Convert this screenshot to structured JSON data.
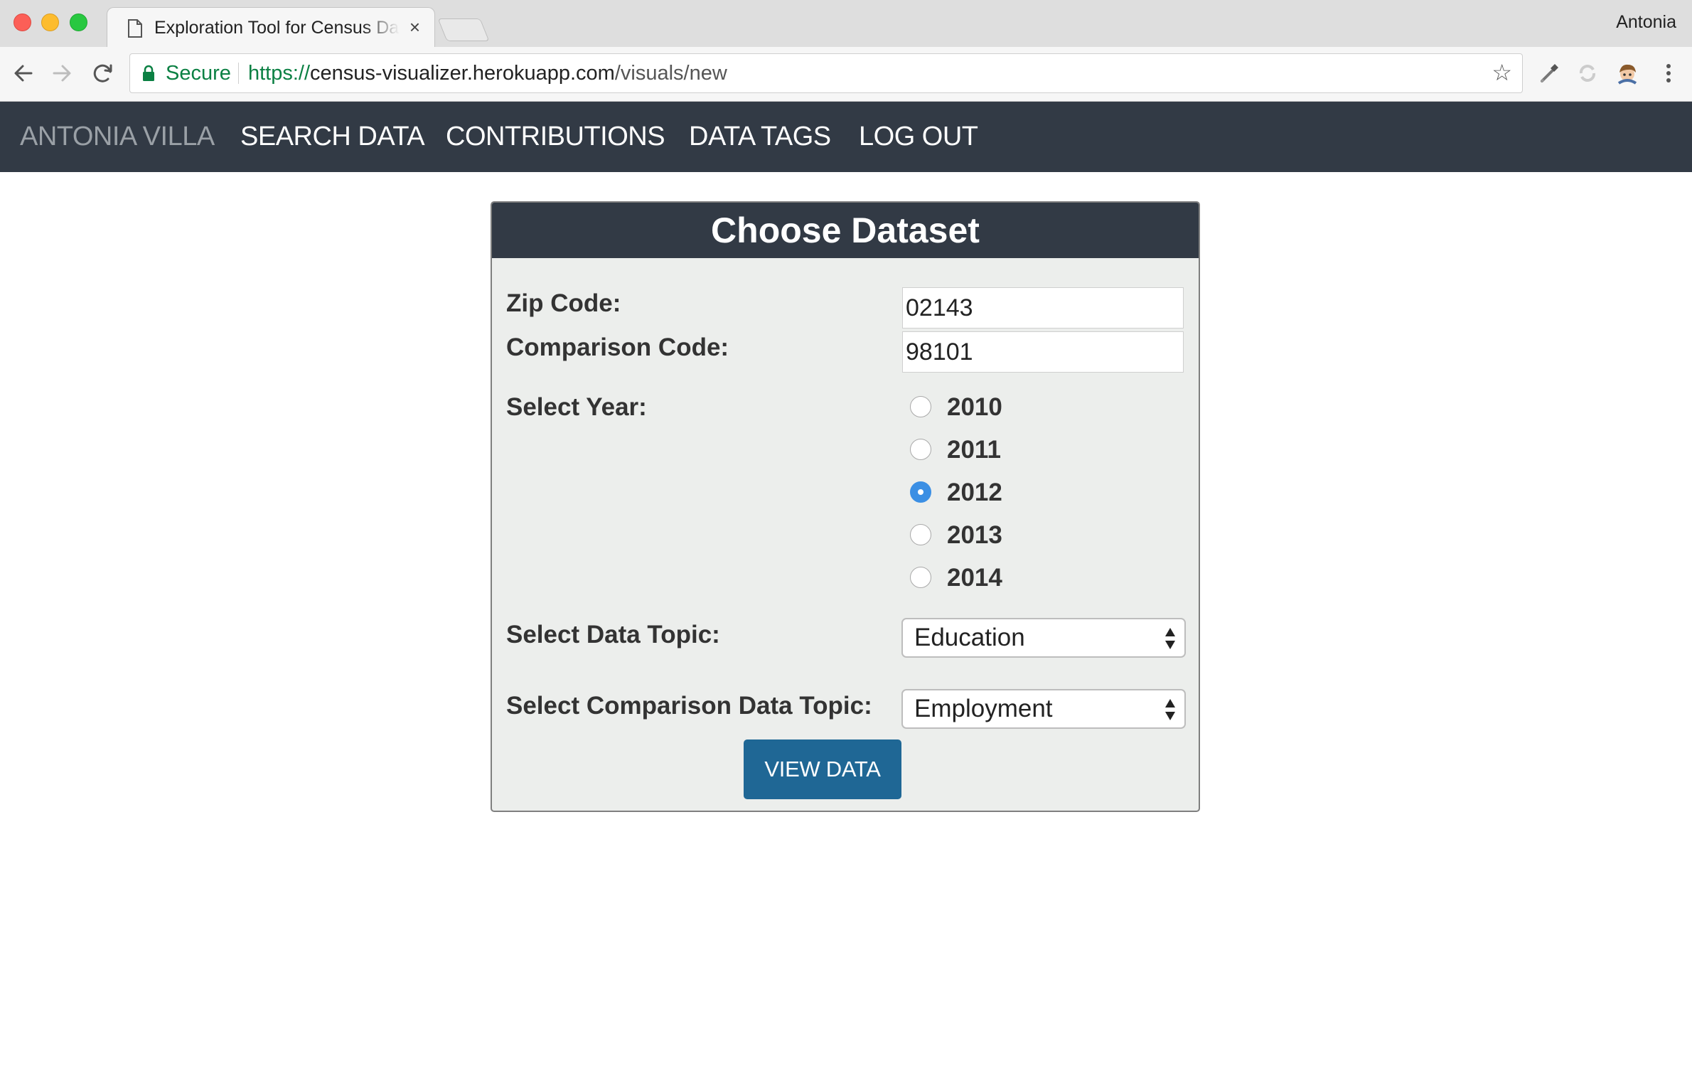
{
  "browser": {
    "tab_title": "Exploration Tool for Census Data",
    "tab_close": "×",
    "profile_name": "Antonia",
    "secure_label": "Secure",
    "url_scheme": "https://",
    "url_host": "census-visualizer.herokuapp.com",
    "url_path": "/visuals/new",
    "bookmark_star": "☆"
  },
  "nav": {
    "brand": "ANTONIA VILLA",
    "items": [
      "SEARCH DATA",
      "CONTRIBUTIONS",
      "DATA TAGS",
      "LOG OUT"
    ]
  },
  "form": {
    "title": "Choose Dataset",
    "zip_label": "Zip Code:",
    "zip_value": "02143",
    "comparison_label": "Comparison Code:",
    "comparison_value": "98101",
    "year_label": "Select Year:",
    "years": [
      "2010",
      "2011",
      "2012",
      "2013",
      "2014"
    ],
    "selected_year": "2012",
    "topic_label": "Select Data Topic:",
    "topic_value": "Education",
    "comparison_topic_label": "Select Comparison Data Topic:",
    "comparison_topic_value": "Employment",
    "submit_label": "VIEW DATA"
  },
  "colors": {
    "nav_bg": "#323a45",
    "button_bg": "#1f6795",
    "radio_checked": "#3b8fe4",
    "secure_green": "#0b8043"
  }
}
